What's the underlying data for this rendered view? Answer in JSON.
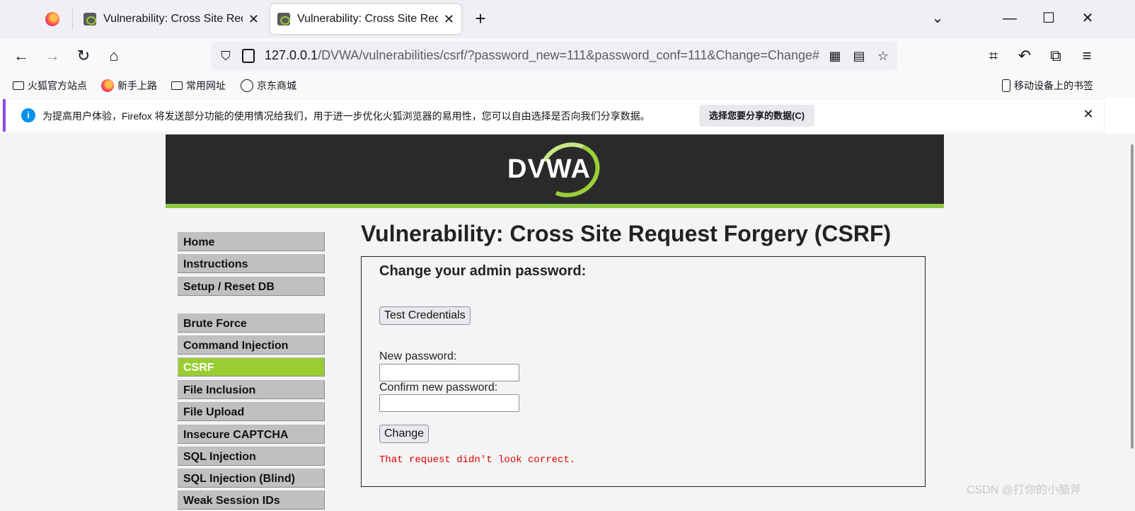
{
  "browser": {
    "tabs": [
      {
        "title": "Vulnerability: Cross Site Request Forgery (CSRF) :: Damn Vulnerable Web Application (DVWA)",
        "close": "✕"
      },
      {
        "title": "Vulnerability: Cross Site Request Forgery (CSRF) :: Damn Vulnerable Web Application (DVWA)",
        "close": "✕"
      }
    ],
    "new_tab_glyph": "+",
    "window_controls": {
      "tabs_list": "⌄",
      "minimize": "—",
      "maximize": "☐",
      "close": "✕"
    },
    "url": {
      "host": "127.0.0.1",
      "path": "/DVWA/vulnerabilities/csrf/?password_new=111&password_conf=111&Change=Change#"
    },
    "bookmarks": [
      {
        "label": "火狐官方站点",
        "icon": "folder-icon"
      },
      {
        "label": "新手上路",
        "icon": "firefox-icon"
      },
      {
        "label": "常用网址",
        "icon": "folder-icon"
      },
      {
        "label": "京东商城",
        "icon": "globe-icon"
      }
    ],
    "mobile_bookmarks": "移动设备上的书签",
    "notification": {
      "text": "为提高用户体验，Firefox 将发送部分功能的使用情况给我们，用于进一步优化火狐浏览器的易用性，您可以自由选择是否向我们分享数据。",
      "button": "选择您要分享的数据(C)",
      "info_glyph": "i",
      "close_glyph": "✕"
    }
  },
  "page": {
    "logo_text": "DVWA",
    "menu": {
      "group1": [
        "Home",
        "Instructions",
        "Setup / Reset DB"
      ],
      "group2": [
        "Brute Force",
        "Command Injection",
        "CSRF",
        "File Inclusion",
        "File Upload",
        "Insecure CAPTCHA",
        "SQL Injection",
        "SQL Injection (Blind)",
        "Weak Session IDs"
      ],
      "selected": "CSRF"
    },
    "title": "Vulnerability: Cross Site Request Forgery (CSRF)",
    "form": {
      "heading": "Change your admin password:",
      "test_button": "Test Credentials",
      "new_password_label": "New password:",
      "new_password_value": "",
      "confirm_password_label": "Confirm new password:",
      "confirm_password_value": "",
      "change_button": "Change",
      "error": "That request didn't look correct."
    }
  },
  "watermark": "CSDN @打你的小脑斧",
  "colors": {
    "accent_green": "#9acd32",
    "error_red": "#e00000",
    "header_dark": "#2a2a2a"
  }
}
